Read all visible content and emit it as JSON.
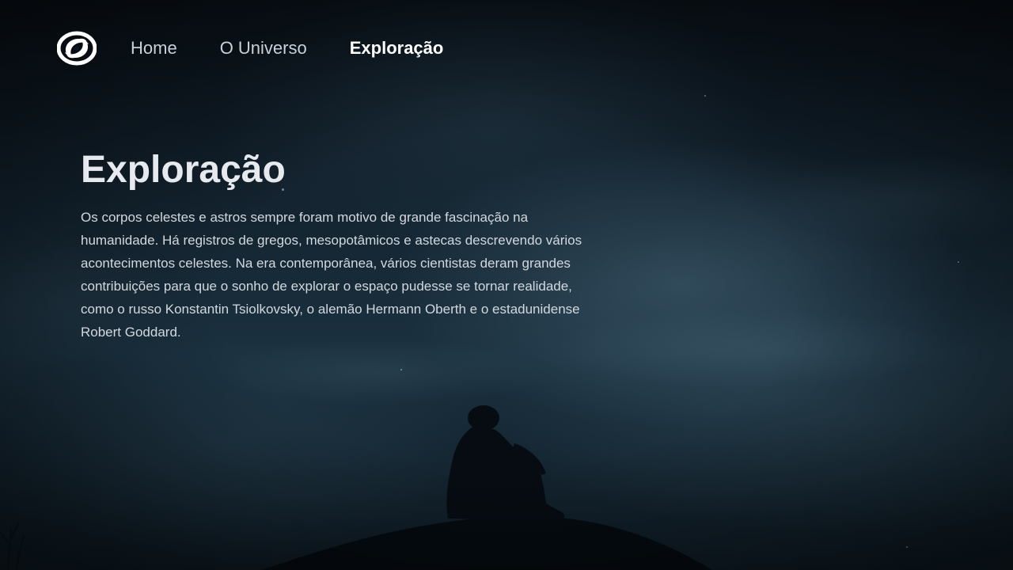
{
  "nav": {
    "logo_icon": "spiral-galaxy-icon",
    "items": [
      {
        "label": "Home",
        "active": false
      },
      {
        "label": "O Universo",
        "active": false
      },
      {
        "label": "Exploração",
        "active": true
      }
    ]
  },
  "main": {
    "title": "Exploração",
    "description": "Os corpos celestes e astros sempre foram motivo de grande fascinação na humanidade. Há registros de gregos, mesopotâmicos e astecas descrevendo vários acontecimentos celestes. Na era contemporânea, vários cientistas deram grandes contribuições para que o sonho de explorar o espaço pudesse se tornar realidade, como o russo Konstantin Tsiolkovsky, o alemão Hermann Oberth e o estadunidense Robert Goddard."
  },
  "colors": {
    "background": "#0b1620",
    "text": "#e6e9ee",
    "nav_text": "#c9d1d9",
    "nav_active": "#ffffff"
  }
}
